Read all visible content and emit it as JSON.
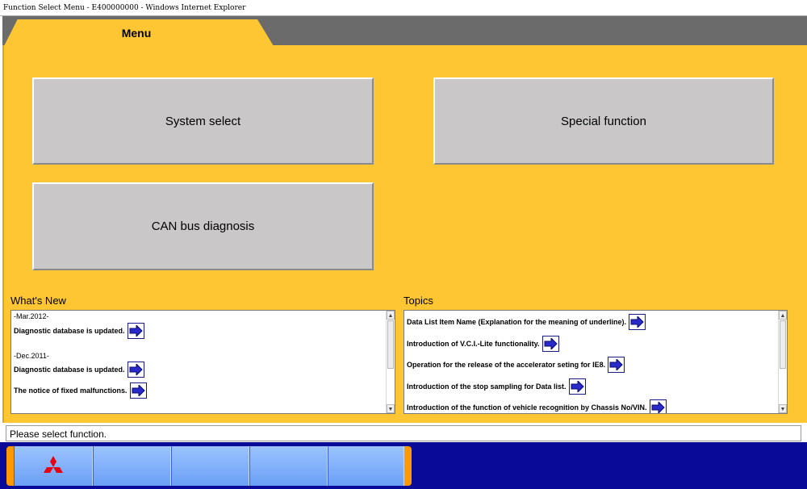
{
  "window": {
    "title": "Function Select Menu - E400000000 - Windows Internet Explorer"
  },
  "tab": {
    "label": "Menu"
  },
  "buttons": {
    "system_select": "System select",
    "special_function": "Special function",
    "can_bus": "CAN bus diagnosis"
  },
  "whats_new": {
    "label": "What's New",
    "entries": [
      {
        "date": "-Mar.2012-"
      },
      {
        "text": "Diagnostic database is updated."
      },
      {
        "date": "-Dec.2011-"
      },
      {
        "text": "Diagnostic database is updated."
      },
      {
        "text": "The notice of fixed malfunctions."
      }
    ]
  },
  "topics": {
    "label": "Topics",
    "entries": [
      {
        "text": "Data List Item Name (Explanation for the meaning of underline)."
      },
      {
        "text": "Introduction of V.C.I.-Lite functionality."
      },
      {
        "text": "Operation for the release of the accelerator seting for IE8."
      },
      {
        "text": "Introduction of the stop sampling for Data list."
      },
      {
        "text": "Introduction of the function of vehicle recognition by Chassis No/VIN."
      }
    ]
  },
  "status": {
    "message": "Please select function."
  },
  "colors": {
    "panel": "#fec632",
    "button": "#c9c7c8",
    "taskbar": "#0a0a99",
    "slot": "#7aaaf8",
    "accent_orange": "#ff9900",
    "logo_red": "#e60012"
  },
  "icons": {
    "link_arrow": "right-arrow-icon",
    "brand": "three-diamonds-logo-icon"
  }
}
